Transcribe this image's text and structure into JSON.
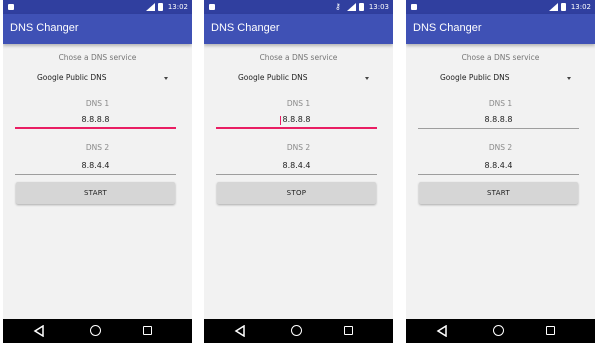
{
  "screens": [
    {
      "status": {
        "time": "13:02",
        "show_key_icon": false
      },
      "app_title": "DNS Changer",
      "service_label": "Chose a DNS service",
      "service_selected": "Google Public DNS",
      "dns1": {
        "label": "DNS 1",
        "value": "8.8.8.8",
        "focused": true
      },
      "dns2": {
        "label": "DNS 2",
        "value": "8.8.4.4"
      },
      "button_label": "START"
    },
    {
      "status": {
        "time": "13:03",
        "show_key_icon": true
      },
      "app_title": "DNS Changer",
      "service_label": "Chose a DNS service",
      "service_selected": "Google Public DNS",
      "dns1": {
        "label": "DNS 1",
        "value": "8.8.8.8",
        "focused": true
      },
      "dns2": {
        "label": "DNS 2",
        "value": "8.8.4.4"
      },
      "button_label": "STOP"
    },
    {
      "status": {
        "time": "13:02",
        "show_key_icon": false
      },
      "app_title": "DNS Changer",
      "service_label": "Chose a DNS service",
      "service_selected": "Google Public DNS",
      "dns1": {
        "label": "DNS 1",
        "value": "8.8.8.8",
        "focused": false
      },
      "dns2": {
        "label": "DNS 2",
        "value": "8.8.4.4"
      },
      "button_label": "START"
    }
  ],
  "colors": {
    "app_bar": "#3f51b5",
    "status_bar": "#303f9f",
    "accent": "#e91e63",
    "button": "#d6d6d6",
    "nav_bar": "#000000"
  },
  "icons": [
    "notification-icon",
    "vpn-key-icon",
    "signal-icon",
    "battery-icon",
    "back-icon",
    "home-icon",
    "recent-apps-icon",
    "dropdown-arrow-icon"
  ]
}
